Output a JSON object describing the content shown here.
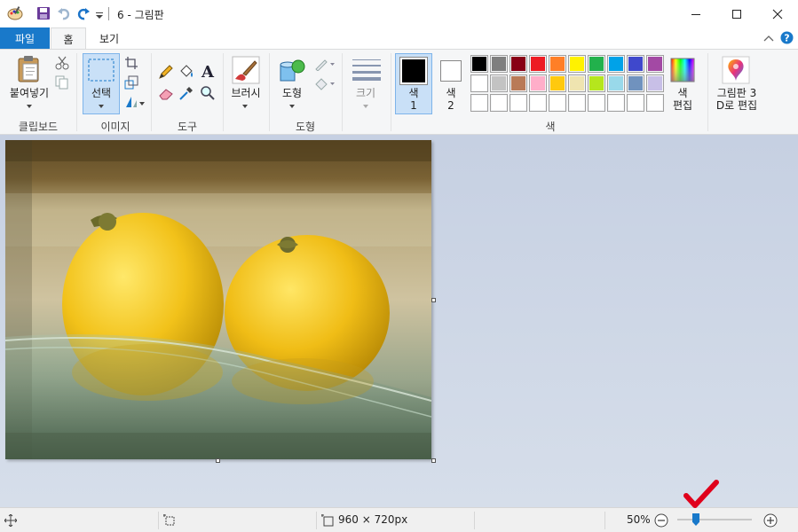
{
  "titlebar": {
    "title": "6 - 그림판",
    "icons": [
      "paint-app-icon",
      "save-icon",
      "undo-icon",
      "redo-icon",
      "customize-quick-access-icon"
    ],
    "window_buttons": [
      "minimize-icon",
      "maximize-icon",
      "close-icon"
    ]
  },
  "tabs": {
    "file": "파일",
    "home": "홈",
    "view": "보기"
  },
  "ribbon": {
    "clipboard": {
      "paste_label": "붙여넣기",
      "group_label": "클립보드",
      "icons": [
        "paste-icon",
        "cut-icon",
        "copy-icon"
      ]
    },
    "image": {
      "select_label": "선택",
      "group_label": "이미지",
      "icons": [
        "select-icon",
        "crop-icon",
        "resize-icon",
        "rotate-icon"
      ]
    },
    "tools": {
      "group_label": "도구",
      "icons": [
        "pencil-icon",
        "fill-icon",
        "text-icon",
        "eraser-icon",
        "color-picker-icon",
        "magnifier-icon"
      ]
    },
    "brushes": {
      "label": "브러시",
      "icons": [
        "brush-icon"
      ]
    },
    "shapes": {
      "label": "도형",
      "group_label": "도형",
      "icons": [
        "shapes-icon",
        "outline-icon",
        "shape-fill-icon"
      ]
    },
    "size": {
      "label": "크기",
      "icons": [
        "size-icon"
      ]
    },
    "colors": {
      "color1_label_line1": "색",
      "color1_label_line2": "1",
      "color2_label_line1": "색",
      "color2_label_line2": "2",
      "edit_label_line1": "색",
      "edit_label_line2": "편집",
      "group_label": "색",
      "color1": "#000000",
      "color2": "#ffffff",
      "palette_row1": [
        "#000000",
        "#7f7f7f",
        "#880015",
        "#ed1c24",
        "#ff7f27",
        "#fff200",
        "#22b14c",
        "#00a2e8",
        "#3f48cc",
        "#a349a4"
      ],
      "palette_row2": [
        "#ffffff",
        "#c3c3c3",
        "#b97a57",
        "#ffaec9",
        "#ffc90e",
        "#efe4b0",
        "#b5e61d",
        "#99d9ea",
        "#7092be",
        "#c8bfe7"
      ],
      "palette_row3": [
        "#ffffff",
        "#ffffff",
        "#ffffff",
        "#ffffff",
        "#ffffff",
        "#ffffff",
        "#ffffff",
        "#ffffff",
        "#ffffff",
        "#ffffff"
      ]
    },
    "paint3d": {
      "label_line1": "그림판 3",
      "label_line2": "D로 편집",
      "icons": [
        "paint3d-icon"
      ]
    },
    "help_icons": [
      "collapse-ribbon-icon",
      "help-icon"
    ]
  },
  "statusbar": {
    "dimensions": "960 × 720px",
    "zoom": "50%",
    "zoom_fraction": 0.5,
    "icons": [
      "cursor-position-icon",
      "selection-size-icon",
      "image-size-icon",
      "zoom-out-icon",
      "zoom-in-icon"
    ]
  },
  "colors": {
    "accent": "#1979ca",
    "workspace": "#c8d1e3",
    "checkmark": "#e0001b"
  }
}
